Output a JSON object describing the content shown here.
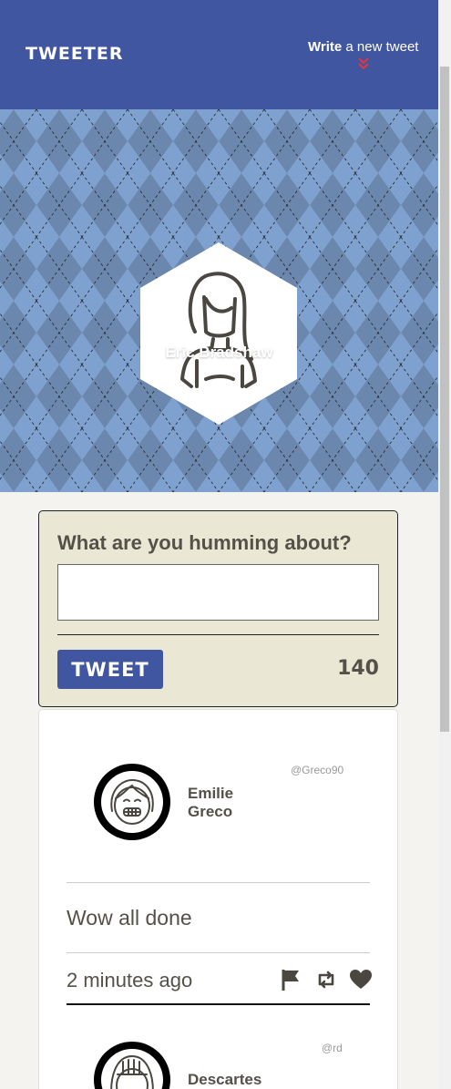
{
  "nav": {
    "brand": "TWEETER",
    "compose_strong": "Write",
    "compose_rest": " a new tweet",
    "chevron_color": "#e8333b"
  },
  "profile": {
    "name": "Eric Bradshaw",
    "avatar_icon": "woman-avatar-icon"
  },
  "composer": {
    "label": "What are you humming about?",
    "textarea_value": "",
    "button_label": "TWEET",
    "counter": "140"
  },
  "tweets": [
    {
      "name": "Emilie Greco",
      "handle": "@Greco90",
      "avatar_icon": "smiling-girl-avatar-icon",
      "text": "Wow all done",
      "time": "2 minutes ago",
      "actions": [
        "flag-icon",
        "retweet-icon",
        "heart-icon"
      ]
    },
    {
      "name": "Descartes",
      "handle": "@rd",
      "avatar_icon": "girl-avatar-icon"
    }
  ],
  "colors": {
    "nav_bg": "#4056a1",
    "composer_bg": "#eae8d5",
    "text": "#545149",
    "argyle_light": "#8fb4e3",
    "argyle_dark": "#6c87ad"
  }
}
